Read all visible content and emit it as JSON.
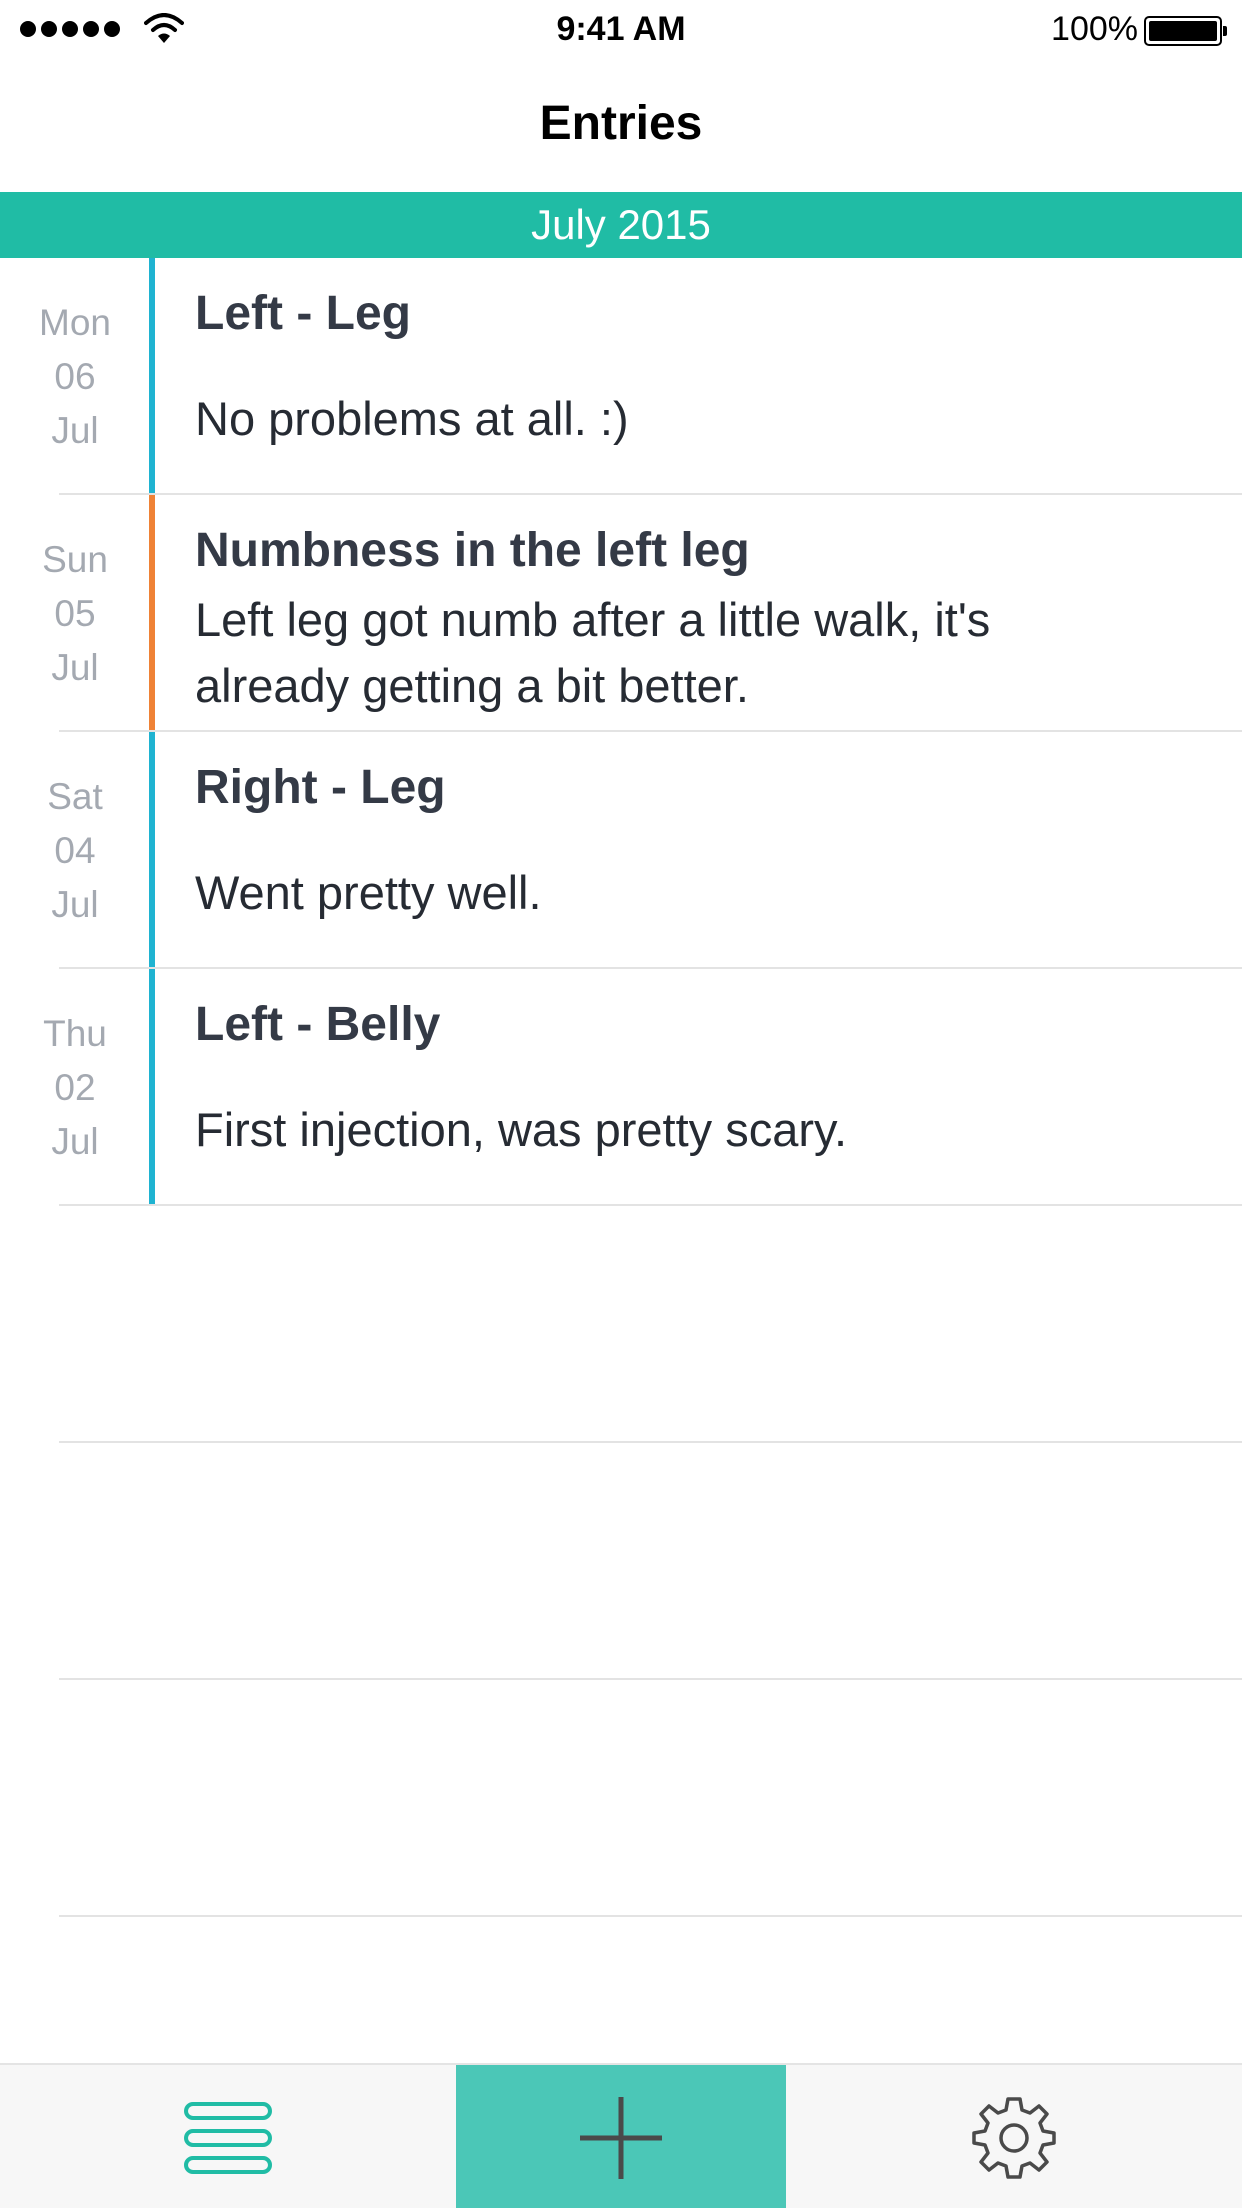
{
  "status_bar": {
    "time": "9:41 AM",
    "battery": "100%",
    "icons": [
      "signal-dots-icon",
      "wifi-icon",
      "battery-icon"
    ]
  },
  "nav": {
    "title": "Entries"
  },
  "month_header": "July 2015",
  "entries": [
    {
      "weekday": "Mon",
      "day": "06",
      "month": "Jul",
      "title": "Left - Leg",
      "body": "No problems at all. :)",
      "marker_color": "#1fb3d1"
    },
    {
      "weekday": "Sun",
      "day": "05",
      "month": "Jul",
      "title": "Numbness in the left leg",
      "body": "Left leg got numb after a little walk, it's already getting a bit better.",
      "marker_color": "#ef8236"
    },
    {
      "weekday": "Sat",
      "day": "04",
      "month": "Jul",
      "title": "Right - Leg",
      "body": "Went pretty well.",
      "marker_color": "#1fb3d1"
    },
    {
      "weekday": "Thu",
      "day": "02",
      "month": "Jul",
      "title": "Left - Belly",
      "body": "First injection, was pretty scary.",
      "marker_color": "#1fb3d1"
    }
  ],
  "tab_bar": {
    "tabs": [
      "list-icon",
      "plus-icon",
      "gear-icon"
    ],
    "colors": {
      "accent": "#20bca5",
      "add_background": "#4bc7b7",
      "icon_dark": "#4a4a4a"
    }
  }
}
